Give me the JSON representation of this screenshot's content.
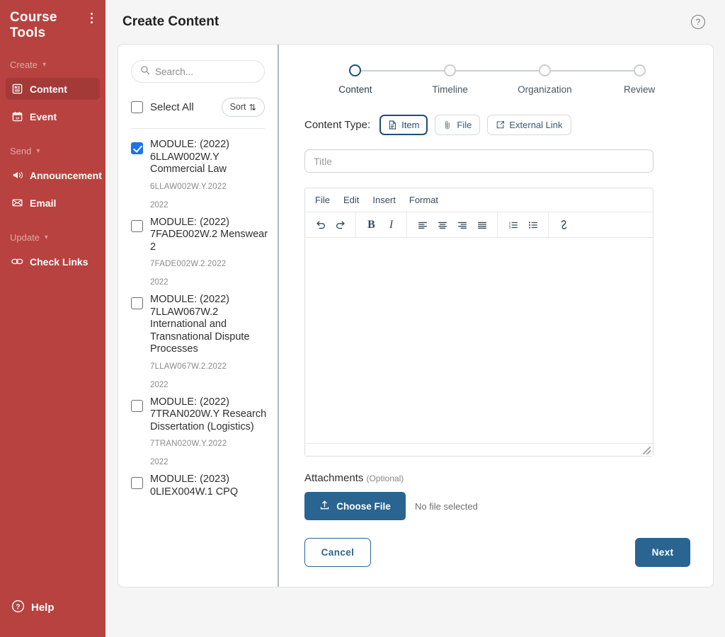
{
  "sidebar": {
    "title": "Course Tools",
    "kebab_icon": "kebab-menu-icon",
    "groups": [
      {
        "label": "Create",
        "chevron": "⌄"
      },
      {
        "label": "Send",
        "chevron": "⌄"
      },
      {
        "label": "Update",
        "chevron": "⌄"
      }
    ],
    "items": [
      {
        "label": "Content",
        "icon": "content-document-icon",
        "active": true
      },
      {
        "label": "Event",
        "icon": "calendar-icon",
        "active": false
      },
      {
        "label": "Announcement",
        "icon": "megaphone-icon",
        "active": false
      },
      {
        "label": "Email",
        "icon": "envelope-icon",
        "active": false
      },
      {
        "label": "Check Links",
        "icon": "link-chain-icon",
        "active": false
      }
    ],
    "help_label": "Help",
    "help_icon": "question-circle-icon",
    "bg_color": "#b8423f",
    "active_bg_color": "#a33a37"
  },
  "header": {
    "title": "Create Content",
    "help_icon": "question-circle-icon"
  },
  "list_panel": {
    "search": {
      "placeholder": "Search...",
      "value": "",
      "icon": "search-icon"
    },
    "select_all_label": "Select All",
    "select_all_checked": false,
    "sort_label": "Sort",
    "sort_icon": "⇅",
    "modules": [
      {
        "name": "MODULE: (2022) 6LLAW002W.Y Commercial Law",
        "code": "6LLAW002W.Y.2022",
        "year": "2022",
        "checked": true
      },
      {
        "name": "MODULE: (2022) 7FADE002W.2 Menswear 2",
        "code": "7FADE002W.2.2022",
        "year": "2022",
        "checked": false
      },
      {
        "name": "MODULE: (2022) 7LLAW067W.2 International and Transnational Dispute Processes",
        "code": "7LLAW067W.2.2022",
        "year": "2022",
        "checked": false
      },
      {
        "name": "MODULE: (2022) 7TRAN020W.Y Research Dissertation (Logistics)",
        "code": "7TRAN020W.Y.2022",
        "year": "2022",
        "checked": false
      },
      {
        "name": "MODULE: (2023) 0LIEX004W.1 CPQ",
        "code": "",
        "year": "",
        "checked": false
      }
    ]
  },
  "form": {
    "steps": [
      {
        "label": "Content",
        "active": true
      },
      {
        "label": "Timeline",
        "active": false
      },
      {
        "label": "Organization",
        "active": false
      },
      {
        "label": "Review",
        "active": false
      }
    ],
    "content_type_label": "Content Type:",
    "content_types": [
      {
        "label": "Item",
        "icon": "document-icon",
        "selected": true
      },
      {
        "label": "File",
        "icon": "paperclip-icon",
        "selected": false
      },
      {
        "label": "External Link",
        "icon": "external-link-icon",
        "selected": false
      }
    ],
    "title_field": {
      "placeholder": "Title",
      "value": ""
    },
    "editor": {
      "menus": [
        "File",
        "Edit",
        "Insert",
        "Format"
      ],
      "tool_groups": [
        [
          {
            "icon": "undo-icon"
          },
          {
            "icon": "redo-icon"
          }
        ],
        [
          {
            "icon": "bold-icon",
            "glyph": "B"
          },
          {
            "icon": "italic-icon",
            "glyph": "I"
          }
        ],
        [
          {
            "icon": "align-left-icon"
          },
          {
            "icon": "align-center-icon"
          },
          {
            "icon": "align-right-icon"
          },
          {
            "icon": "align-justify-icon"
          }
        ],
        [
          {
            "icon": "numbered-list-icon"
          },
          {
            "icon": "bullet-list-icon"
          }
        ],
        [
          {
            "icon": "link-icon"
          }
        ]
      ],
      "body_text": "",
      "resize_handle_icon": "resize-grip-icon"
    },
    "attachments_label": "Attachments",
    "attachments_optional": "(Optional)",
    "choose_file_label": "Choose File",
    "choose_file_icon": "upload-icon",
    "no_file_text": "No file selected",
    "cancel_label": "Cancel",
    "next_label": "Next",
    "accent_color": "#2a6490",
    "step_active_color": "#1f4e79"
  }
}
